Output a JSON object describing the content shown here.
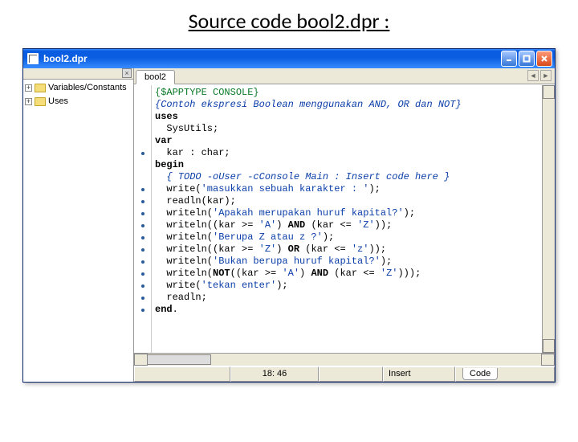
{
  "heading": "Source code bool2.dpr :",
  "titlebar": {
    "title": "bool2.dpr"
  },
  "win_buttons": {
    "min": "_",
    "max": "□",
    "close": "✕"
  },
  "tree": {
    "close": "×",
    "items": [
      {
        "expand": "+",
        "label": "Variables/Constants"
      },
      {
        "expand": "+",
        "label": "Uses"
      }
    ]
  },
  "editor": {
    "tab": "bool2",
    "nav_left": "◄",
    "nav_right": "►",
    "code_tab": "Code"
  },
  "code": [
    {
      "dot": false,
      "segs": [
        {
          "t": "dir",
          "v": "{$APPTYPE CONSOLE}"
        }
      ]
    },
    {
      "dot": false,
      "segs": [
        {
          "t": "cm",
          "v": "{Contoh ekspresi Boolean menggunakan AND, OR dan NOT}"
        }
      ]
    },
    {
      "dot": false,
      "segs": [
        {
          "t": "kw",
          "v": "uses"
        }
      ]
    },
    {
      "dot": false,
      "segs": [
        {
          "t": "p",
          "v": "  SysUtils;"
        }
      ]
    },
    {
      "dot": false,
      "segs": [
        {
          "t": "kw",
          "v": "var"
        }
      ]
    },
    {
      "dot": true,
      "segs": [
        {
          "t": "p",
          "v": "  kar : char;"
        }
      ]
    },
    {
      "dot": false,
      "segs": [
        {
          "t": "kw",
          "v": "begin"
        }
      ]
    },
    {
      "dot": false,
      "segs": [
        {
          "t": "p",
          "v": "  "
        },
        {
          "t": "cm",
          "v": "{ TODO -oUser -cConsole Main : Insert code here }"
        }
      ]
    },
    {
      "dot": true,
      "segs": [
        {
          "t": "p",
          "v": "  write("
        },
        {
          "t": "str",
          "v": "'masukkan sebuah karakter : '"
        },
        {
          "t": "p",
          "v": ");"
        }
      ]
    },
    {
      "dot": true,
      "segs": [
        {
          "t": "p",
          "v": "  readln(kar);"
        }
      ]
    },
    {
      "dot": true,
      "segs": [
        {
          "t": "p",
          "v": "  writeln("
        },
        {
          "t": "str",
          "v": "'Apakah merupakan huruf kapital?'"
        },
        {
          "t": "p",
          "v": ");"
        }
      ]
    },
    {
      "dot": true,
      "segs": [
        {
          "t": "p",
          "v": "  writeln((kar >= "
        },
        {
          "t": "str",
          "v": "'A'"
        },
        {
          "t": "p",
          "v": ") "
        },
        {
          "t": "kw",
          "v": "AND"
        },
        {
          "t": "p",
          "v": " (kar <= "
        },
        {
          "t": "str",
          "v": "'Z'"
        },
        {
          "t": "p",
          "v": "));"
        }
      ]
    },
    {
      "dot": true,
      "segs": [
        {
          "t": "p",
          "v": "  writeln("
        },
        {
          "t": "str",
          "v": "'Berupa Z atau z ?'"
        },
        {
          "t": "p",
          "v": ");"
        }
      ]
    },
    {
      "dot": true,
      "segs": [
        {
          "t": "p",
          "v": "  writeln((kar >= "
        },
        {
          "t": "str",
          "v": "'Z'"
        },
        {
          "t": "p",
          "v": ") "
        },
        {
          "t": "kw",
          "v": "OR"
        },
        {
          "t": "p",
          "v": " (kar <= "
        },
        {
          "t": "str",
          "v": "'z'"
        },
        {
          "t": "p",
          "v": "));"
        }
      ]
    },
    {
      "dot": true,
      "segs": [
        {
          "t": "p",
          "v": "  writeln("
        },
        {
          "t": "str",
          "v": "'Bukan berupa huruf kapital?'"
        },
        {
          "t": "p",
          "v": ");"
        }
      ]
    },
    {
      "dot": true,
      "segs": [
        {
          "t": "p",
          "v": "  writeln("
        },
        {
          "t": "kw",
          "v": "NOT"
        },
        {
          "t": "p",
          "v": "((kar >= "
        },
        {
          "t": "str",
          "v": "'A'"
        },
        {
          "t": "p",
          "v": ") "
        },
        {
          "t": "kw",
          "v": "AND"
        },
        {
          "t": "p",
          "v": " (kar <= "
        },
        {
          "t": "str",
          "v": "'Z'"
        },
        {
          "t": "p",
          "v": ")));"
        }
      ]
    },
    {
      "dot": true,
      "segs": [
        {
          "t": "p",
          "v": "  write("
        },
        {
          "t": "str",
          "v": "'tekan enter'"
        },
        {
          "t": "p",
          "v": ");"
        }
      ]
    },
    {
      "dot": true,
      "segs": [
        {
          "t": "p",
          "v": "  readln;"
        }
      ]
    },
    {
      "dot": true,
      "segs": [
        {
          "t": "kw",
          "v": "end"
        },
        {
          "t": "p",
          "v": "."
        }
      ]
    }
  ],
  "status": {
    "blank1": " ",
    "pos": "18: 46",
    "blank2": " ",
    "mode": "Insert"
  }
}
